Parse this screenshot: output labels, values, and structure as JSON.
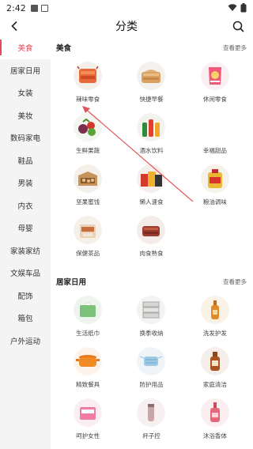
{
  "status_bar": {
    "time": "2:42"
  },
  "header": {
    "title": "分类",
    "back_icon": "arrow-left-icon",
    "search_icon": "search-icon"
  },
  "sidebar": {
    "items": [
      {
        "label": "美食",
        "active": true
      },
      {
        "label": "居家日用"
      },
      {
        "label": "女装"
      },
      {
        "label": "美妆"
      },
      {
        "label": "数码家电"
      },
      {
        "label": "鞋品"
      },
      {
        "label": "男装"
      },
      {
        "label": "内衣"
      },
      {
        "label": "母婴"
      },
      {
        "label": "家装家纺"
      },
      {
        "label": "文娱车品"
      },
      {
        "label": "配饰"
      },
      {
        "label": "箱包"
      },
      {
        "label": "户外运动"
      }
    ]
  },
  "sections": [
    {
      "title": "美食",
      "more": "查看更多",
      "items": [
        {
          "label": "辣味零食",
          "icon": "spicy-snack-icon"
        },
        {
          "label": "快捷早餐",
          "icon": "bread-icon"
        },
        {
          "label": "休闲零食",
          "icon": "chips-icon"
        },
        {
          "label": "生鲜果蔬",
          "icon": "fruit-icon"
        },
        {
          "label": "酒水饮料",
          "icon": "bottles-icon"
        },
        {
          "label": "幸福甜品",
          "icon": "dessert-icon"
        },
        {
          "label": "坚果蜜饯",
          "icon": "nuts-box-icon"
        },
        {
          "label": "懒人速食",
          "icon": "instant-food-icon"
        },
        {
          "label": "粮油调味",
          "icon": "oil-icon"
        },
        {
          "label": "保健茶品",
          "icon": "tea-icon"
        },
        {
          "label": "肉食熟食",
          "icon": "meat-icon"
        }
      ]
    },
    {
      "title": "居家日用",
      "more": "查看更多",
      "items": [
        {
          "label": "生活纸巾",
          "icon": "tissue-icon"
        },
        {
          "label": "换季收纳",
          "icon": "storage-icon"
        },
        {
          "label": "洗发护发",
          "icon": "shampoo-icon"
        },
        {
          "label": "精致餐具",
          "icon": "pot-icon"
        },
        {
          "label": "防护用品",
          "icon": "mask-icon"
        },
        {
          "label": "家庭清洁",
          "icon": "cleaner-icon"
        },
        {
          "label": "呵护女性",
          "icon": "pads-icon"
        },
        {
          "label": "杯子控",
          "icon": "cup-icon"
        },
        {
          "label": "沐浴香体",
          "icon": "bodywash-icon"
        }
      ]
    }
  ],
  "colors": {
    "accent": "#e54a5a",
    "sidebar_bg": "#f4f4f4",
    "arrow": "#e0555a"
  }
}
